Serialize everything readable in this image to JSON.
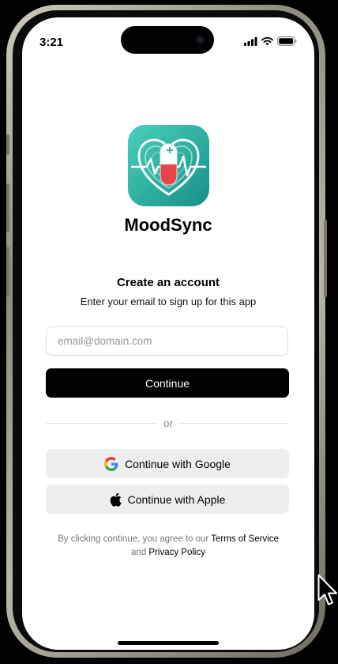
{
  "status_bar": {
    "time": "3:21"
  },
  "app": {
    "name": "MoodSync"
  },
  "signup": {
    "heading": "Create an account",
    "subheading": "Enter your email to sign up for this app",
    "email_placeholder": "email@domain.com",
    "email_value": "",
    "continue_label": "Continue",
    "divider_text": "or"
  },
  "social": {
    "google_label": "Continue with Google",
    "apple_label": "Continue with Apple"
  },
  "legal": {
    "prefix": "By clicking continue, you agree to our",
    "terms_label": "Terms of Service",
    "and": "and",
    "privacy_label": "Privacy Policy"
  },
  "colors": {
    "primary_button": "#000000",
    "social_button_bg": "#eeeeee",
    "logo_teal": "#2fb9a6",
    "logo_red": "#e8434b"
  },
  "icons": [
    "signal-icon",
    "wifi-icon",
    "battery-icon",
    "google-icon",
    "apple-icon",
    "mouse-cursor-icon"
  ]
}
